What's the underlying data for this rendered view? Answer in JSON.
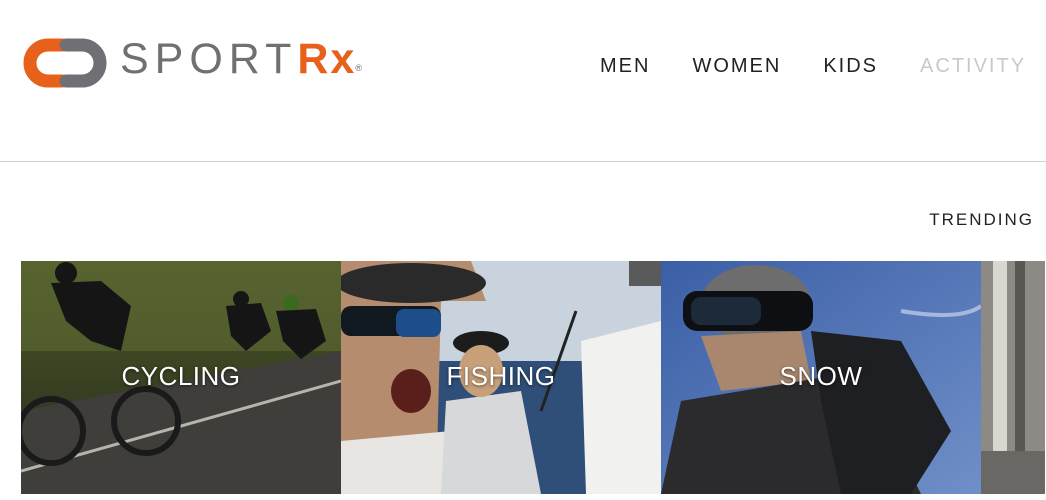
{
  "brand": {
    "name_main": "SPORT",
    "name_accent": "Rx",
    "registered": "®",
    "colors": {
      "accent": "#e8611a",
      "gray": "#6f7073"
    }
  },
  "nav": {
    "items": [
      {
        "label": "MEN",
        "state": "normal"
      },
      {
        "label": "WOMEN",
        "state": "normal"
      },
      {
        "label": "KIDS",
        "state": "normal"
      },
      {
        "label": "ACTIVITY",
        "state": "faded"
      }
    ]
  },
  "trending": {
    "label": "TRENDING",
    "tiles": [
      {
        "label": "CYCLING"
      },
      {
        "label": "FISHING"
      },
      {
        "label": "SNOW"
      }
    ]
  }
}
